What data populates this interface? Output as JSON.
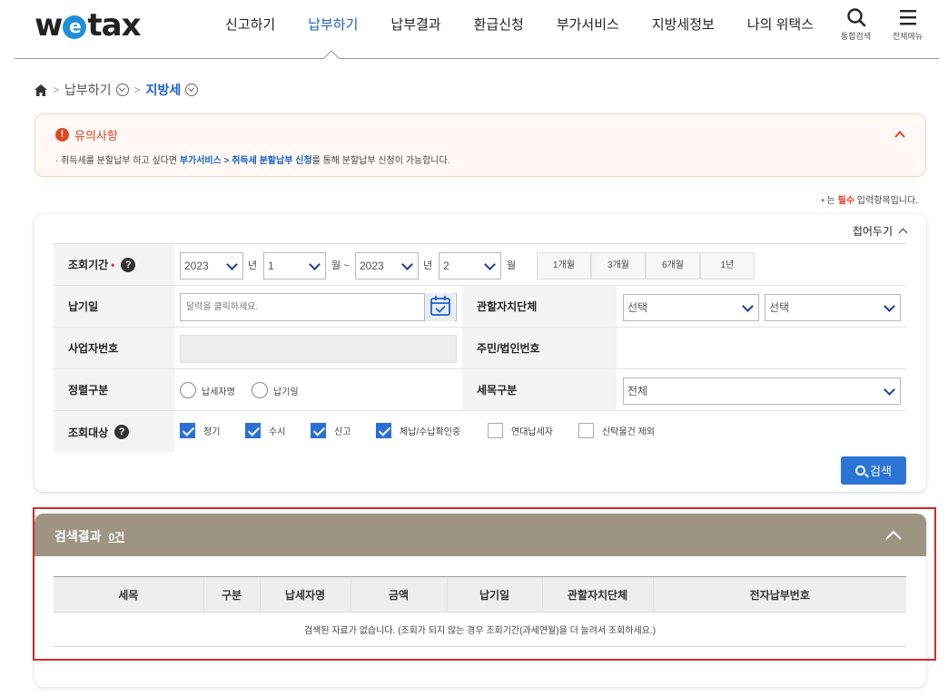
{
  "header": {
    "logo": {
      "prefix": "w",
      "e": "e",
      "suffix": "tax"
    },
    "nav": [
      "신고하기",
      "납부하기",
      "납부결과",
      "환급신청",
      "부가서비스",
      "지방세정보",
      "나의 위택스"
    ],
    "active_index": 1,
    "search_label": "통합검색",
    "menu_label": "전체메뉴"
  },
  "breadcrumb": {
    "level1": "납부하기",
    "level2": "지방세"
  },
  "notice": {
    "title": "유의사항",
    "text_before": "· 취득세를 분할납부 하고 싶다면 ",
    "link": "부가서비스 > 취득세 분할납부 신청",
    "text_after": "를 통해 분할납부 신청이 가능합니다."
  },
  "required_note": {
    "dot": "•",
    "mid": " 는 ",
    "req": "필수",
    "after": " 입력항목입니다."
  },
  "search_form": {
    "fold_label": "접어두기",
    "period": {
      "label": "조회기간",
      "required_mark": "•",
      "help": "?",
      "start_year": "2023",
      "start_year_unit": "년",
      "start_month": "1",
      "start_month_unit": "월 ~",
      "end_year": "2023",
      "end_year_unit": "년",
      "end_month": "2",
      "end_month_unit": "월",
      "quick": [
        "1개월",
        "3개월",
        "6개월",
        "1년"
      ]
    },
    "due_date": {
      "label": "납기일",
      "placeholder": "달력을 클릭하세요."
    },
    "jurisdiction": {
      "label": "관할자치단체",
      "select1": "선택",
      "select2": "선택"
    },
    "biz_no": {
      "label": "사업자번호"
    },
    "resident_no": {
      "label": "주민/법인번호"
    },
    "sort": {
      "label": "정렬구분",
      "options": [
        "납세자명",
        "납기일"
      ]
    },
    "tax_type": {
      "label": "세목구분",
      "value": "전체"
    },
    "target": {
      "label": "조회대상",
      "help": "?",
      "options": [
        {
          "label": "정기",
          "checked": true
        },
        {
          "label": "수시",
          "checked": true
        },
        {
          "label": "신고",
          "checked": true
        },
        {
          "label": "체납/수납확인중",
          "checked": true
        },
        {
          "label": "연대납세자",
          "checked": false
        },
        {
          "label": "신탁물건 제외",
          "checked": false
        }
      ]
    },
    "search_button": "검색"
  },
  "results": {
    "title": "검색결과",
    "count": "0건",
    "columns": [
      "세목",
      "구분",
      "납세자명",
      "금액",
      "납기일",
      "관할자치단체",
      "전자납부번호"
    ],
    "empty_message": "검색된 자료가 없습니다. (조회가 되지 않는 경우 조회기간(과세연월)을 더 늘려서 조회하세요.)"
  }
}
